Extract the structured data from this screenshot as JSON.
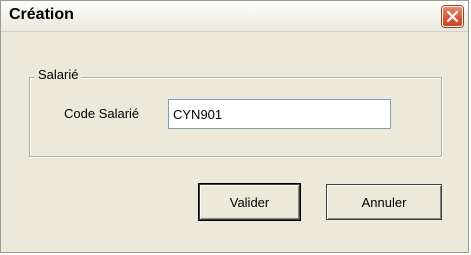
{
  "window": {
    "title": "Création",
    "close_icon": "close-icon"
  },
  "group": {
    "legend": "Salarié"
  },
  "employee_code": {
    "label": "Code Salarié",
    "value": "CYN901"
  },
  "buttons": {
    "ok_label": "Valider",
    "cancel_label": "Annuler"
  },
  "colors": {
    "close_button": "#d55a35",
    "dialog_background": "#ece9d8"
  }
}
